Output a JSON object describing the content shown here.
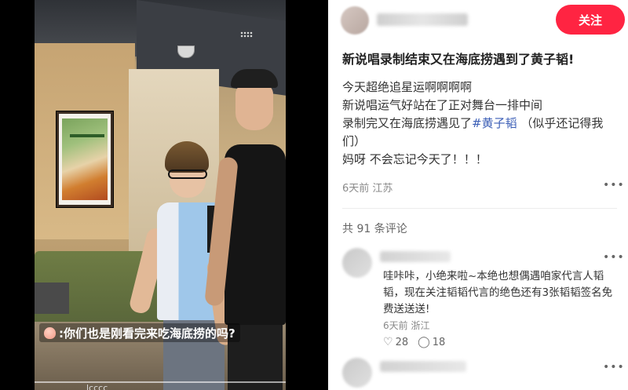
{
  "video": {
    "caption": ":你们也是刚看完来吃海底捞的吗?",
    "bottom_text": "lcccc"
  },
  "post": {
    "follow_label": "关注",
    "title": "新说唱录制结束又在海底捞遇到了黄子韬!",
    "lines": [
      "今天超绝追星运啊啊啊啊",
      "新说唱运气好站在了正对舞台一排中间"
    ],
    "line3_prefix": "录制完又在海底捞遇见了",
    "line3_tag": "#黄子韬",
    "line3_suffix": " （似乎还记得我们）",
    "line4": "妈呀 不会忘记今天了！！！",
    "meta": "6天前 江苏",
    "comment_count": "共 91 条评论"
  },
  "comments": [
    {
      "text": "哇咔咔，小绝来啦~本绝也想偶遇咱家代言人韬韬，现在关注韬韬代言的绝色还有3张韬韬签名免费送送送!",
      "meta": "6天前 浙江",
      "likes": "28",
      "replies": "18"
    }
  ],
  "icons": {
    "more": "more-icon",
    "heart": "heart-icon",
    "comment": "comment-bubble-icon",
    "peach": "peach-icon"
  },
  "colors": {
    "accent": "#ff2442",
    "hashtag": "#3b5eb6"
  }
}
